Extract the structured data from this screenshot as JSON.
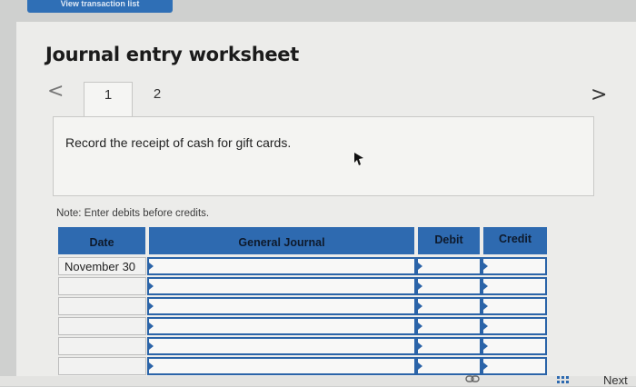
{
  "page": {
    "title": "Journal entry worksheet",
    "top_button_label": "View transaction list"
  },
  "nav": {
    "prev_icon": "chevron-left-icon",
    "next_icon": "chevron-right-icon",
    "prev_glyph": "<",
    "next_glyph": ">"
  },
  "tabs": [
    {
      "label": "1",
      "active": true
    },
    {
      "label": "2",
      "active": false
    }
  ],
  "instruction": "Record the receipt of cash for gift cards.",
  "note": "Note: Enter debits before credits.",
  "table": {
    "headers": {
      "date": "Date",
      "general_journal": "General Journal",
      "debit": "Debit",
      "credit": "Credit"
    },
    "rows": [
      {
        "date": "November 30",
        "account": "",
        "debit": "",
        "credit": ""
      },
      {
        "date": "",
        "account": "",
        "debit": "",
        "credit": ""
      },
      {
        "date": "",
        "account": "",
        "debit": "",
        "credit": ""
      },
      {
        "date": "",
        "account": "",
        "debit": "",
        "credit": ""
      },
      {
        "date": "",
        "account": "",
        "debit": "",
        "credit": ""
      },
      {
        "date": "",
        "account": "",
        "debit": "",
        "credit": ""
      }
    ]
  },
  "footer": {
    "next_label": "Next"
  },
  "colors": {
    "header_blue": "#2e6ab0",
    "input_border": "#2b64a8",
    "panel_bg": "#ececea"
  }
}
